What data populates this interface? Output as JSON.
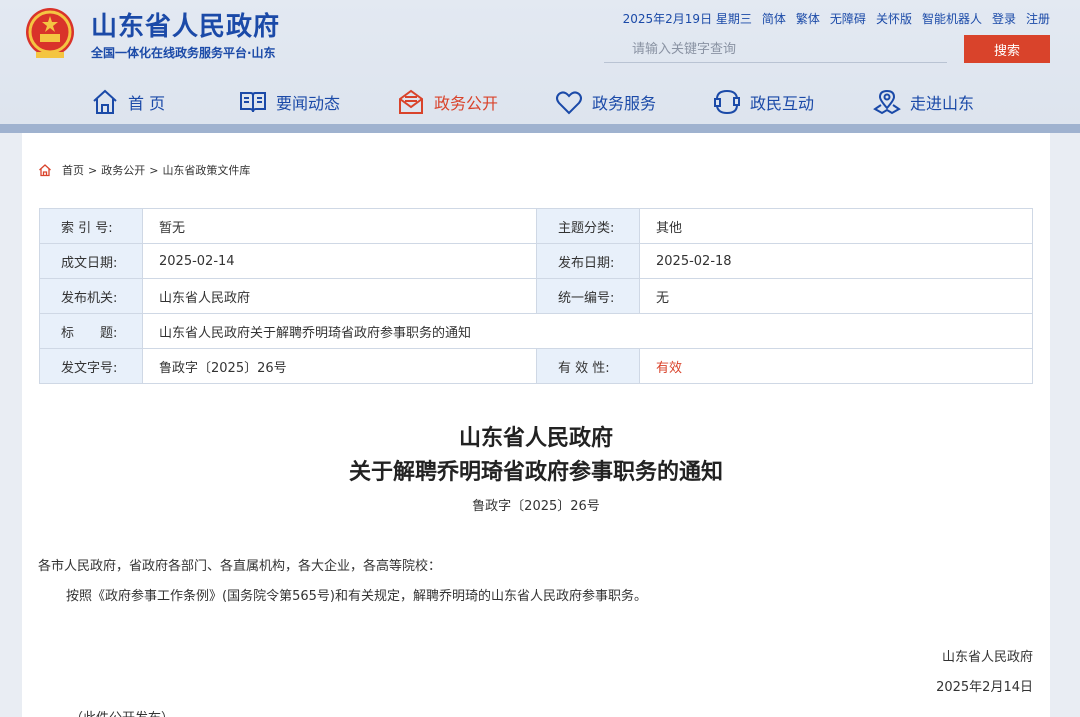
{
  "header": {
    "site_title": "山东省人民政府",
    "site_subtitle": "全国一体化在线政务服务平台·山东",
    "top_links": [
      "2025年2月19日 星期三",
      "简体",
      "繁体",
      "无障碍",
      "关怀版",
      "智能机器人",
      "登录",
      "注册"
    ],
    "search": {
      "placeholder": "请输入关键字查询",
      "button_label": "搜索"
    },
    "nav": [
      {
        "label": "首 页",
        "icon": "home-icon"
      },
      {
        "label": "要闻动态",
        "icon": "book-icon"
      },
      {
        "label": "政务公开",
        "icon": "mail-icon",
        "active": true
      },
      {
        "label": "政务服务",
        "icon": "heart-icon"
      },
      {
        "label": "政民互动",
        "icon": "interaction-icon"
      },
      {
        "label": "走进山东",
        "icon": "map-pin-icon"
      }
    ],
    "accent_color": "#1b4aa8",
    "active_color": "#d9432b"
  },
  "breadcrumb": {
    "items": [
      "首页",
      "政务公开",
      "山东省政策文件库"
    ],
    "separator": ">"
  },
  "meta": {
    "index_label": "索 引 号:",
    "index_value": "暂无",
    "topic_label": "主题分类:",
    "topic_value": "其他",
    "created_label": "成文日期:",
    "created_value": "2025-02-14",
    "published_label": "发布日期:",
    "published_value": "2025-02-18",
    "issuer_label": "发布机关:",
    "issuer_value": "山东省人民政府",
    "serial_label": "统一编号:",
    "serial_value": "无",
    "title_label": "标　　题:",
    "title_value": "山东省人民政府关于解聘乔明琦省政府参事职务的通知",
    "docno_label": "发文字号:",
    "docno_value": "鲁政字〔2025〕26号",
    "validity_label": "有 效 性:",
    "validity_value": "有效"
  },
  "document": {
    "title_line1": "山东省人民政府",
    "title_line2": "关于解聘乔明琦省政府参事职务的通知",
    "doc_number": "鲁政字〔2025〕26号",
    "recipients": "各市人民政府，省政府各部门、各直属机构，各大企业，各高等院校：",
    "body": "按照《政府参事工作条例》(国务院令第565号)和有关规定，解聘乔明琦的山东省人民政府参事职务。",
    "signature": "山东省人民政府",
    "date": "2025年2月14日",
    "publication_note": "（此件公开发布）"
  }
}
